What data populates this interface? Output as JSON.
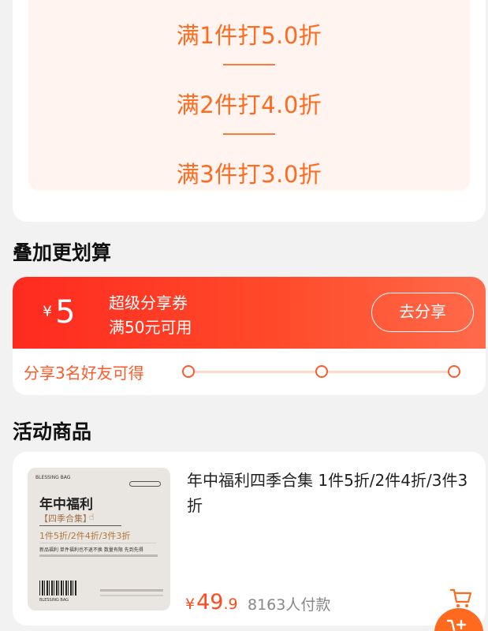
{
  "discount_tiers": [
    {
      "label": "满1件打5.0折"
    },
    {
      "label": "满2件打4.0折"
    },
    {
      "label": "满3件打3.0折"
    }
  ],
  "stack_section": {
    "title": "叠加更划算"
  },
  "coupon": {
    "currency": "¥",
    "amount": "5",
    "name": "超级分享券",
    "condition": "满50元可用",
    "action_label": "去分享",
    "progress_label": "分享3名好友可得",
    "progress_steps": 3
  },
  "products_section": {
    "title": "活动商品"
  },
  "product": {
    "title": "年中福利四季合集 1件5折/2件4折/3件3折",
    "price_currency": "¥",
    "price_int": "49",
    "price_dec": ".9",
    "sales": "8163人付款",
    "thumbnail": {
      "brand": "BLESSING BAG",
      "title": "年中福利",
      "subtitle": "【四季合集】",
      "promo": "1件5折/2件4折/3件3折",
      "note": "新品福利 单件福利也不退不换 数量有限 先到先得",
      "barcode_label": "BLESSING BAG"
    }
  },
  "icons": {
    "cart": "cart-icon",
    "float": "floating-cart-icon"
  },
  "colors": {
    "accent": "#ff6a1f",
    "coupon_red": "#ff2a1f",
    "price": "#ff4a1f"
  }
}
